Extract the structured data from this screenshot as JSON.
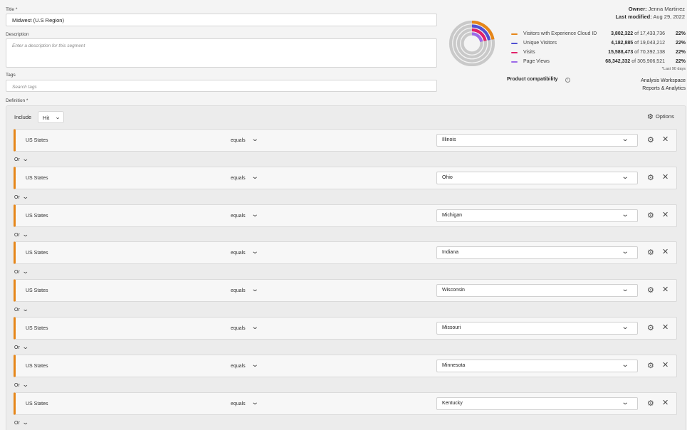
{
  "form": {
    "title_label": "Title *",
    "title_value": "Midwest (U.S Region)",
    "description_label": "Description",
    "description_placeholder": "Enter a description for this segment",
    "tags_label": "Tags",
    "tags_placeholder": "Search tags",
    "definition_label": "Definition *"
  },
  "meta": {
    "owner_label": "Owner:",
    "owner_name": "Jenna Martinez",
    "modified_label": "Last modified:",
    "modified_date": "Aug 29, 2022"
  },
  "summary": {
    "metrics": [
      {
        "name": "Visitors with Experience Cloud ID",
        "value": "3,802,322",
        "of": "of 17,433,736",
        "pct": "22%",
        "color": "#e68619"
      },
      {
        "name": "Unique Visitors",
        "value": "4,182,885",
        "of": "of 19,043,212",
        "pct": "22%",
        "color": "#5151d3"
      },
      {
        "name": "Visits",
        "value": "15,588,473",
        "of": "of 70,392,138",
        "pct": "22%",
        "color": "#e2216a"
      },
      {
        "name": "Page Views",
        "value": "68,342,332",
        "of": "of 305,906,521",
        "pct": "22%",
        "color": "#9b6ae8"
      }
    ],
    "note": "*Last 90 days",
    "compat_label": "Product compatibility",
    "compat_values": [
      "Analysis Workspace",
      "Reports & Analytics"
    ]
  },
  "definition": {
    "include_label": "Include",
    "container": "Hit",
    "options_label": "Options",
    "connector": "Or",
    "rules": [
      {
        "dimension": "US States",
        "operator": "equals",
        "value": "Illinois"
      },
      {
        "dimension": "US States",
        "operator": "equals",
        "value": "Ohio"
      },
      {
        "dimension": "US States",
        "operator": "equals",
        "value": "Michigan"
      },
      {
        "dimension": "US States",
        "operator": "equals",
        "value": "Indiana"
      },
      {
        "dimension": "US States",
        "operator": "equals",
        "value": "Wisconsin"
      },
      {
        "dimension": "US States",
        "operator": "equals",
        "value": "Missouri"
      },
      {
        "dimension": "US States",
        "operator": "equals",
        "value": "Minnesota"
      },
      {
        "dimension": "US States",
        "operator": "equals",
        "value": "Kentucky"
      }
    ]
  },
  "icons": {
    "gear": "gear-icon",
    "close": "close-icon",
    "chevron": "chevron-down-icon",
    "info": "info-icon"
  }
}
